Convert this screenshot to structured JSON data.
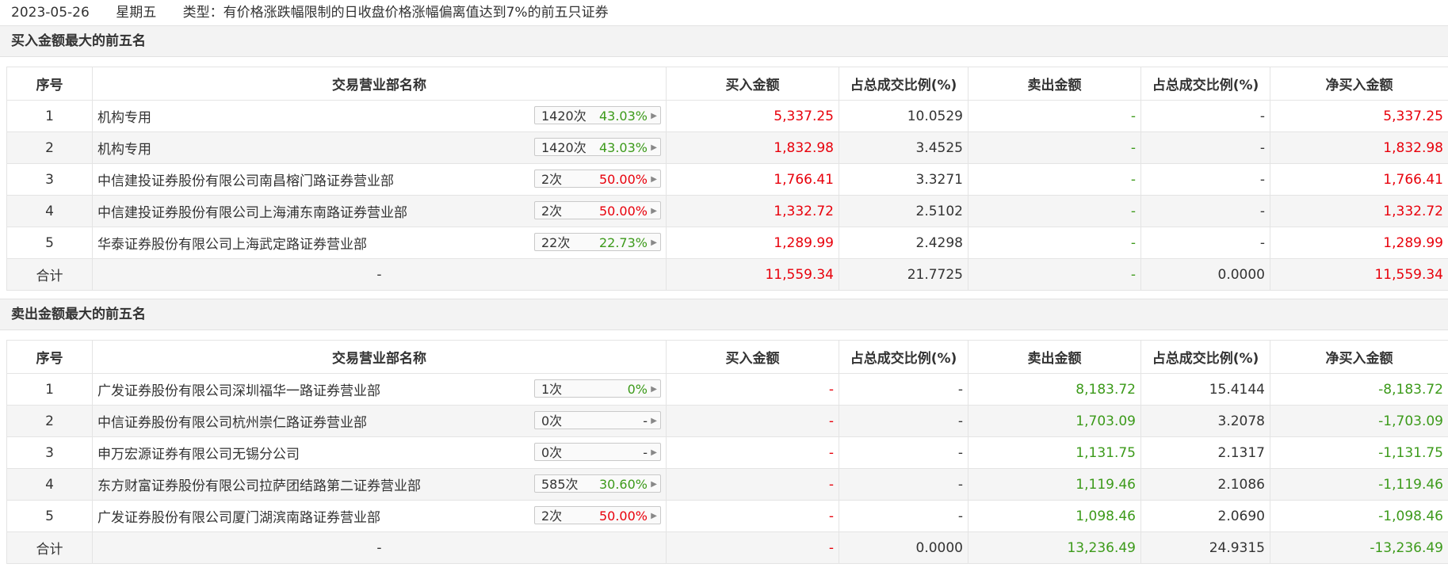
{
  "header": {
    "date": "2023-05-26",
    "weekday": "星期五",
    "type_text": "类型：有价格涨跌幅限制的日收盘价格涨幅偏离值达到7%的前五只证券"
  },
  "columns": [
    "序号",
    "交易营业部名称",
    "买入金额",
    "占总成交比例(%)",
    "卖出金额",
    "占总成交比例(%)",
    "净买入金额"
  ],
  "colors": {
    "red": "#e8000b",
    "green": "#3c9a1a"
  },
  "buy_section": {
    "title": "买入金额最大的前五名",
    "rows": [
      {
        "idx": "1",
        "name": "机构专用",
        "count": "1420次",
        "pct": "43.03%",
        "pct_color": "green",
        "buy": "5,337.25",
        "buy_ratio": "10.0529",
        "sell": "-",
        "sell_ratio": "-",
        "net": "5,337.25"
      },
      {
        "idx": "2",
        "name": "机构专用",
        "count": "1420次",
        "pct": "43.03%",
        "pct_color": "green",
        "buy": "1,832.98",
        "buy_ratio": "3.4525",
        "sell": "-",
        "sell_ratio": "-",
        "net": "1,832.98"
      },
      {
        "idx": "3",
        "name": "中信建投证券股份有限公司南昌榕门路证券营业部",
        "count": "2次",
        "pct": "50.00%",
        "pct_color": "red",
        "buy": "1,766.41",
        "buy_ratio": "3.3271",
        "sell": "-",
        "sell_ratio": "-",
        "net": "1,766.41"
      },
      {
        "idx": "4",
        "name": "中信建投证券股份有限公司上海浦东南路证券营业部",
        "count": "2次",
        "pct": "50.00%",
        "pct_color": "red",
        "buy": "1,332.72",
        "buy_ratio": "2.5102",
        "sell": "-",
        "sell_ratio": "-",
        "net": "1,332.72"
      },
      {
        "idx": "5",
        "name": "华泰证券股份有限公司上海武定路证券营业部",
        "count": "22次",
        "pct": "22.73%",
        "pct_color": "green",
        "buy": "1,289.99",
        "buy_ratio": "2.4298",
        "sell": "-",
        "sell_ratio": "-",
        "net": "1,289.99"
      }
    ],
    "total": {
      "label": "合计",
      "name": "-",
      "buy": "11,559.34",
      "buy_ratio": "21.7725",
      "sell": "-",
      "sell_ratio": "0.0000",
      "net": "11,559.34"
    }
  },
  "sell_section": {
    "title": "卖出金额最大的前五名",
    "rows": [
      {
        "idx": "1",
        "name": "广发证券股份有限公司深圳福华一路证券营业部",
        "count": "1次",
        "pct": "0%",
        "pct_color": "green",
        "buy": "-",
        "buy_ratio": "-",
        "sell": "8,183.72",
        "sell_ratio": "15.4144",
        "net": "-8,183.72"
      },
      {
        "idx": "2",
        "name": "中信证券股份有限公司杭州崇仁路证券营业部",
        "count": "0次",
        "pct": "-",
        "pct_color": "black",
        "buy": "-",
        "buy_ratio": "-",
        "sell": "1,703.09",
        "sell_ratio": "3.2078",
        "net": "-1,703.09"
      },
      {
        "idx": "3",
        "name": "申万宏源证券有限公司无锡分公司",
        "count": "0次",
        "pct": "-",
        "pct_color": "black",
        "buy": "-",
        "buy_ratio": "-",
        "sell": "1,131.75",
        "sell_ratio": "2.1317",
        "net": "-1,131.75"
      },
      {
        "idx": "4",
        "name": "东方财富证券股份有限公司拉萨团结路第二证券营业部",
        "count": "585次",
        "pct": "30.60%",
        "pct_color": "green",
        "buy": "-",
        "buy_ratio": "-",
        "sell": "1,119.46",
        "sell_ratio": "2.1086",
        "net": "-1,119.46"
      },
      {
        "idx": "5",
        "name": "广发证券股份有限公司厦门湖滨南路证券营业部",
        "count": "2次",
        "pct": "50.00%",
        "pct_color": "red",
        "buy": "-",
        "buy_ratio": "-",
        "sell": "1,098.46",
        "sell_ratio": "2.0690",
        "net": "-1,098.46"
      }
    ],
    "total": {
      "label": "合计",
      "name": "-",
      "buy": "-",
      "buy_ratio": "0.0000",
      "sell": "13,236.49",
      "sell_ratio": "24.9315",
      "net": "-13,236.49"
    }
  }
}
